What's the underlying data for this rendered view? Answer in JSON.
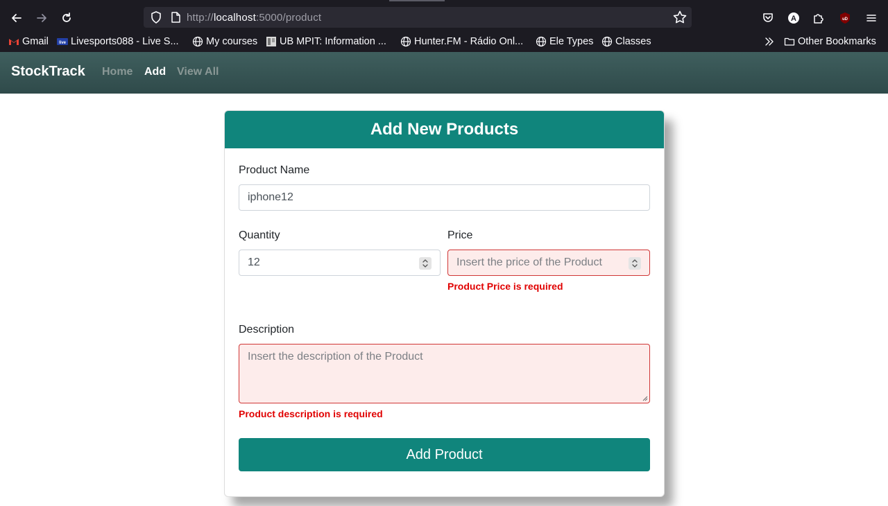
{
  "browser": {
    "url_prefix": "http://",
    "url_host": "localhost",
    "url_path": ":5000/product",
    "bookmarks": [
      {
        "label": "Gmail",
        "icon": "gmail-icon"
      },
      {
        "label": "Livesports088 - Live S...",
        "icon": "livesports-icon"
      },
      {
        "label": "My courses",
        "icon": "globe-icon"
      },
      {
        "label": "UB MPIT: Information ...",
        "icon": "ub-icon"
      },
      {
        "label": "Hunter.FM - Rádio Onl...",
        "icon": "globe-icon"
      },
      {
        "label": "Ele Types",
        "icon": "globe-icon"
      },
      {
        "label": "Classes",
        "icon": "globe-icon"
      }
    ],
    "other_bookmarks": "Other Bookmarks"
  },
  "app": {
    "brand": "StockTrack",
    "nav": [
      {
        "label": "Home"
      },
      {
        "label": "Add"
      },
      {
        "label": "View All"
      }
    ]
  },
  "form": {
    "title": "Add New Products",
    "product_name_label": "Product Name",
    "product_name_value": "iphone12",
    "quantity_label": "Quantity",
    "quantity_value": "12",
    "price_label": "Price",
    "price_placeholder": "Insert the price of the Product",
    "price_error": "Product Price is required",
    "description_label": "Description",
    "description_placeholder": "Insert the description of the Product",
    "description_error": "Product description is required",
    "submit_label": "Add Product"
  },
  "colors": {
    "accent": "#10857c",
    "navbar": "#2f4a4a",
    "error": "#e00000",
    "invalid_bg": "#fdeceb"
  }
}
